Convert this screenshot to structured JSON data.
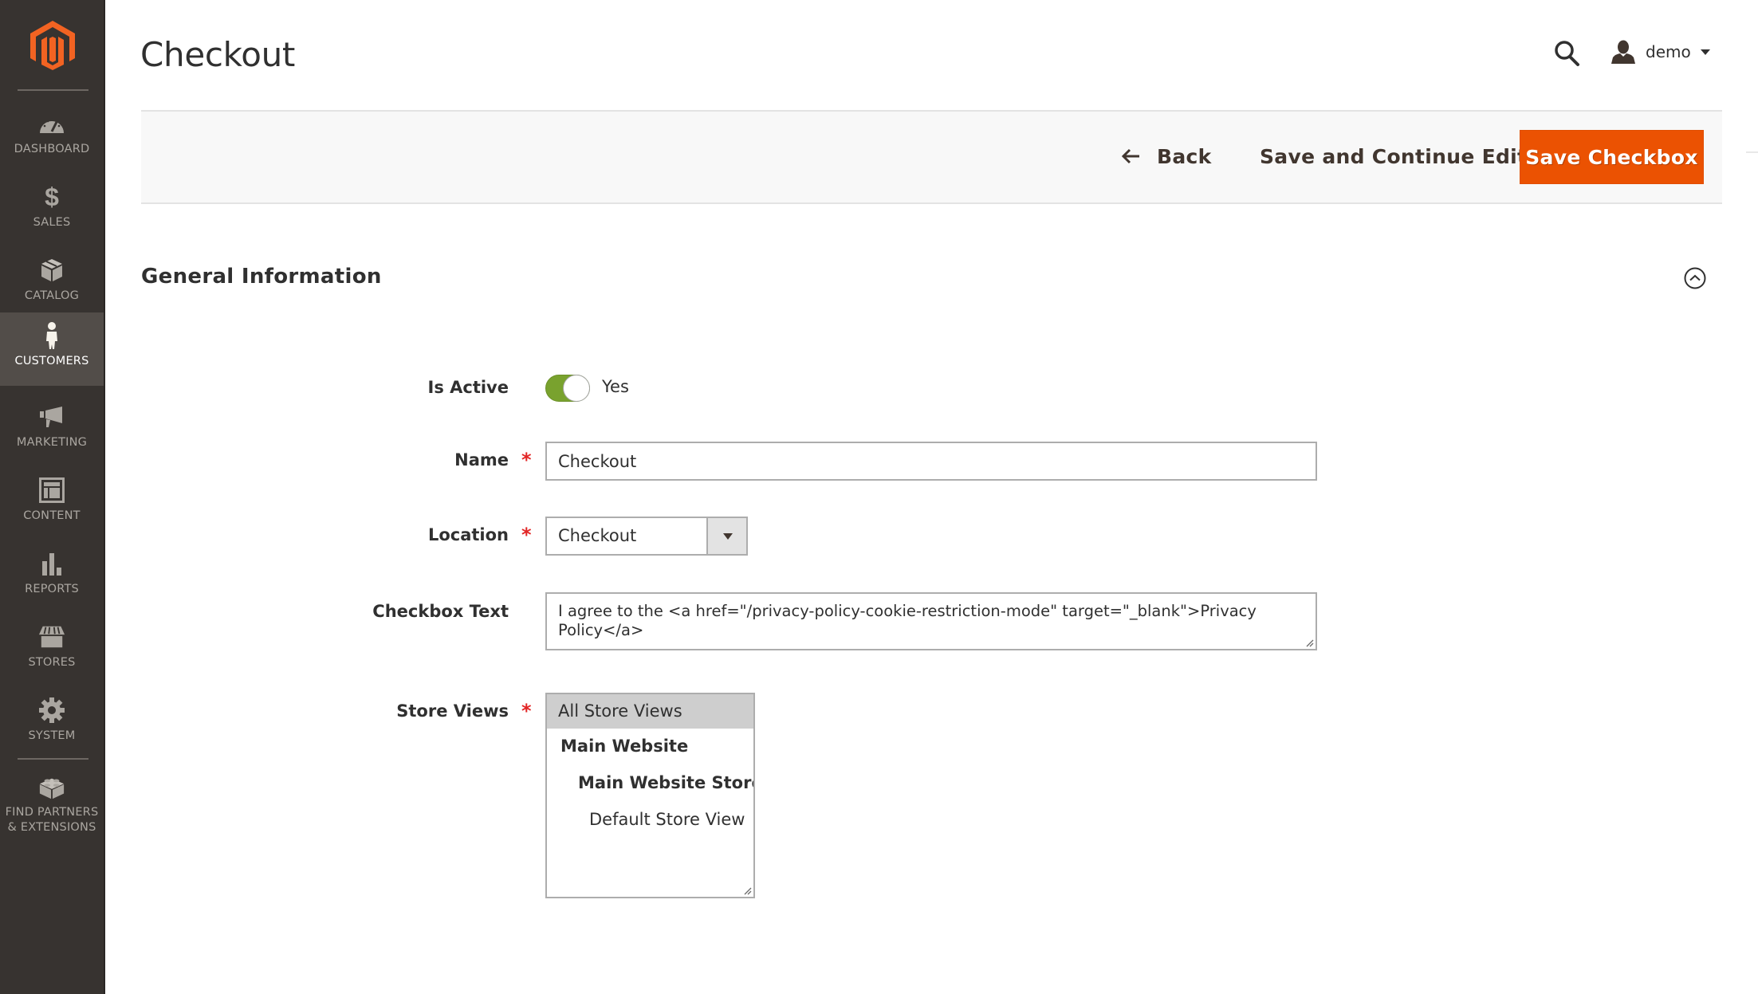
{
  "sidebar": {
    "logo": "magento-logo",
    "items": [
      {
        "label": "Dashboard",
        "icon": "dashboard-icon",
        "active": false
      },
      {
        "label": "Sales",
        "icon": "dollar-icon",
        "active": false
      },
      {
        "label": "Catalog",
        "icon": "box-icon",
        "active": false
      },
      {
        "label": "Customers",
        "icon": "person-icon",
        "active": true
      },
      {
        "label": "Marketing",
        "icon": "megaphone-icon",
        "active": false
      },
      {
        "label": "Content",
        "icon": "layout-icon",
        "active": false
      },
      {
        "label": "Reports",
        "icon": "bar-chart-icon",
        "active": false
      },
      {
        "label": "Stores",
        "icon": "storefront-icon",
        "active": false
      },
      {
        "label": "System",
        "icon": "gear-icon",
        "active": false
      },
      {
        "label": "Find Partners & Extensions",
        "icon": "lego-brick-icon",
        "active": false
      }
    ]
  },
  "header": {
    "title": "Checkout",
    "user_name": "demo"
  },
  "actions": {
    "back_label": "Back",
    "save_continue_label": "Save and Continue Edit",
    "save_label": "Save Checkbox"
  },
  "colors": {
    "primary_button": "#eb5202",
    "toggle_on": "#79a22e",
    "sidebar_bg": "#373330",
    "logo": "#f26322",
    "required": "#e22626"
  },
  "section": {
    "title": "General Information",
    "expanded": true
  },
  "form": {
    "is_active": {
      "label": "Is Active",
      "value": true,
      "value_text": "Yes"
    },
    "name": {
      "label": "Name",
      "required": true,
      "value": "Checkout"
    },
    "location": {
      "label": "Location",
      "required": true,
      "selected": "Checkout"
    },
    "checkbox_text": {
      "label": "Checkbox Text",
      "required": false,
      "value": "I agree to the <a href=\"/privacy-policy-cookie-restriction-mode\" target=\"_blank\">Privacy Policy</a>"
    },
    "store_views": {
      "label": "Store Views",
      "required": true,
      "options": [
        {
          "label": "All Store Views",
          "selected": true,
          "level": 0,
          "bold": false
        },
        {
          "label": "Main Website",
          "selected": false,
          "level": 0,
          "bold": true
        },
        {
          "label": "Main Website Store",
          "selected": false,
          "level": 1,
          "bold": true
        },
        {
          "label": "Default Store View",
          "selected": false,
          "level": 2,
          "bold": false
        }
      ]
    }
  }
}
